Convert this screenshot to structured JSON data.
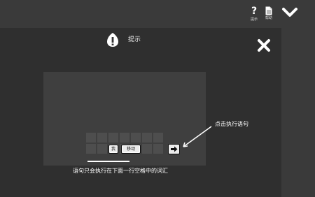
{
  "toolbar": {
    "help_label": "提示",
    "doc_label": "帮助"
  },
  "hint": {
    "title": "提示",
    "callout": "点击执行语句",
    "caption": "语句只会执行在下面一行空格中的词汇"
  },
  "sentence": {
    "words": [
      "我",
      "移动"
    ]
  },
  "colors": {
    "background": "#2f2f2f",
    "topbar": "#3a3a3a",
    "panel": "#3f3f3f",
    "cell": "#4e4e4e",
    "chip": "#ececec"
  },
  "icons": [
    "help-icon",
    "document-icon",
    "chevron-down-icon",
    "hint-icon",
    "close-icon",
    "arrow-right-icon"
  ]
}
